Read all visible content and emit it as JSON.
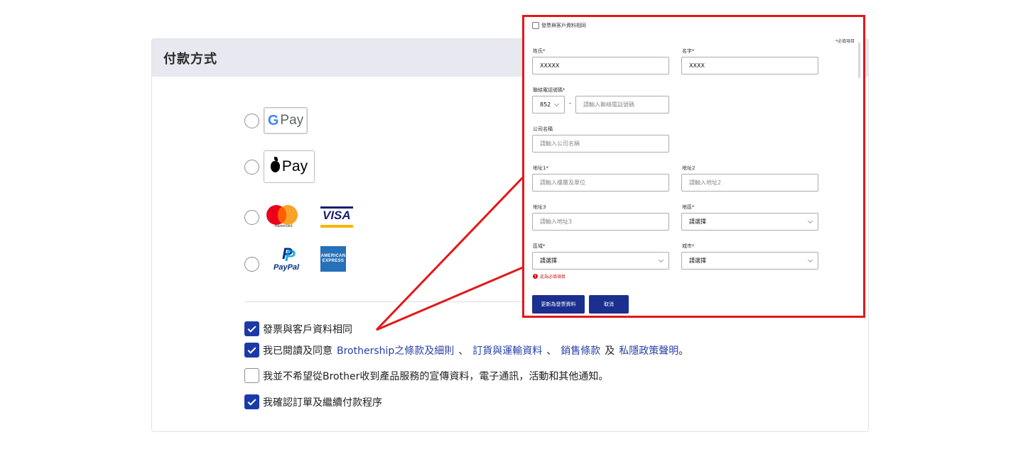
{
  "payment": {
    "title": "付款方式",
    "gpay_label": "Pay",
    "gpay_g": "G",
    "applepay_label": "Pay",
    "mastercard_text": "mastercard",
    "visa_text": "VISA",
    "paypal_text": "PayPal",
    "paypal_mark": "P",
    "amex_line1": "AMERICAN",
    "amex_line2": "EXPRESS"
  },
  "checks": {
    "same_as_customer": "發票與客戶資料相同",
    "agree_prefix": "我已閱讀及同意",
    "agree_link1": "Brothership之條款及細則",
    "sep1": "、",
    "agree_link2": "訂貨與運輸資料",
    "sep2": "、",
    "agree_link3": "銷售條款",
    "agree_and": "及",
    "agree_link4": "私隱政策聲明",
    "agree_end": "。",
    "no_promo": "我並不希望從Brother收到產品服務的宣傳資料，電子通訊，活動和其他通知。",
    "confirm": "我確認訂單及繼續付款程序"
  },
  "popup": {
    "same_as_customer": "發票與客戶資料相同",
    "required_note": "*必填項目",
    "surname_label": "姓氏*",
    "surname_value": "XXXXX",
    "firstname_label": "名字*",
    "firstname_value": "XXXX",
    "phone_label": "聯絡電話號碼*",
    "phone_code": "852",
    "phone_dash": "-",
    "phone_placeholder": "請輸入聯絡電話號碼",
    "company_label": "公司名稱",
    "company_placeholder": "請輸入公司名稱",
    "addr1_label": "地址1*",
    "addr1_placeholder": "請輸入樓層及單位",
    "addr2_label": "地址2",
    "addr2_placeholder": "請輸入地址2",
    "addr3_label": "地址3",
    "addr3_placeholder": "請輸入地址3",
    "region_label": "地區*",
    "region_value": "請選擇",
    "district_label": "區域*",
    "district_value": "請選擇",
    "city_label": "城市*",
    "city_value": "請選擇",
    "error_text": "此為必填項目",
    "update_button": "更新為發票資料",
    "cancel_button": "取消"
  },
  "colors": {
    "accent": "#1b3aa8",
    "callout": "#e41818",
    "header_bg": "#e7e8f0"
  }
}
